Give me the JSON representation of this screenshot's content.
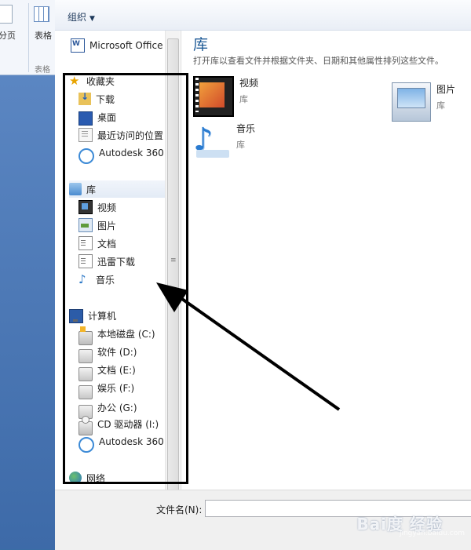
{
  "background": {
    "ribbon": {
      "label_left": "分页",
      "label_table": "表格",
      "group_label": "表格"
    }
  },
  "toolbar": {
    "organize_label": "组织"
  },
  "nav": {
    "office": "Microsoft Office",
    "favorites": {
      "header": "收藏夹",
      "items": [
        "下载",
        "桌面",
        "最近访问的位置",
        "Autodesk 360"
      ]
    },
    "libraries": {
      "header": "库",
      "items": [
        "视频",
        "图片",
        "文档",
        "迅雷下载",
        "音乐"
      ]
    },
    "computer": {
      "header": "计算机",
      "items": [
        "本地磁盘 (C:)",
        "软件 (D:)",
        "文档 (E:)",
        "娱乐 (F:)",
        "办公 (G:)",
        "CD 驱动器 (I:)",
        "Autodesk 360"
      ]
    },
    "network": "网络"
  },
  "content": {
    "title": "库",
    "description": "打开库以查看文件并根据文件夹、日期和其他属性排列这些文件。",
    "tiles": [
      {
        "name": "视频",
        "type": "库"
      },
      {
        "name": "图片",
        "type": "库"
      },
      {
        "name": "音乐",
        "type": "库"
      }
    ]
  },
  "bottom": {
    "filename_label": "文件名(N):",
    "filename_value": ""
  },
  "watermark": {
    "brand": "Bai度 经验",
    "url": "jingyan.baidu.com"
  },
  "colors": {
    "accent": "#1e5a96",
    "annotation": "#000000"
  }
}
